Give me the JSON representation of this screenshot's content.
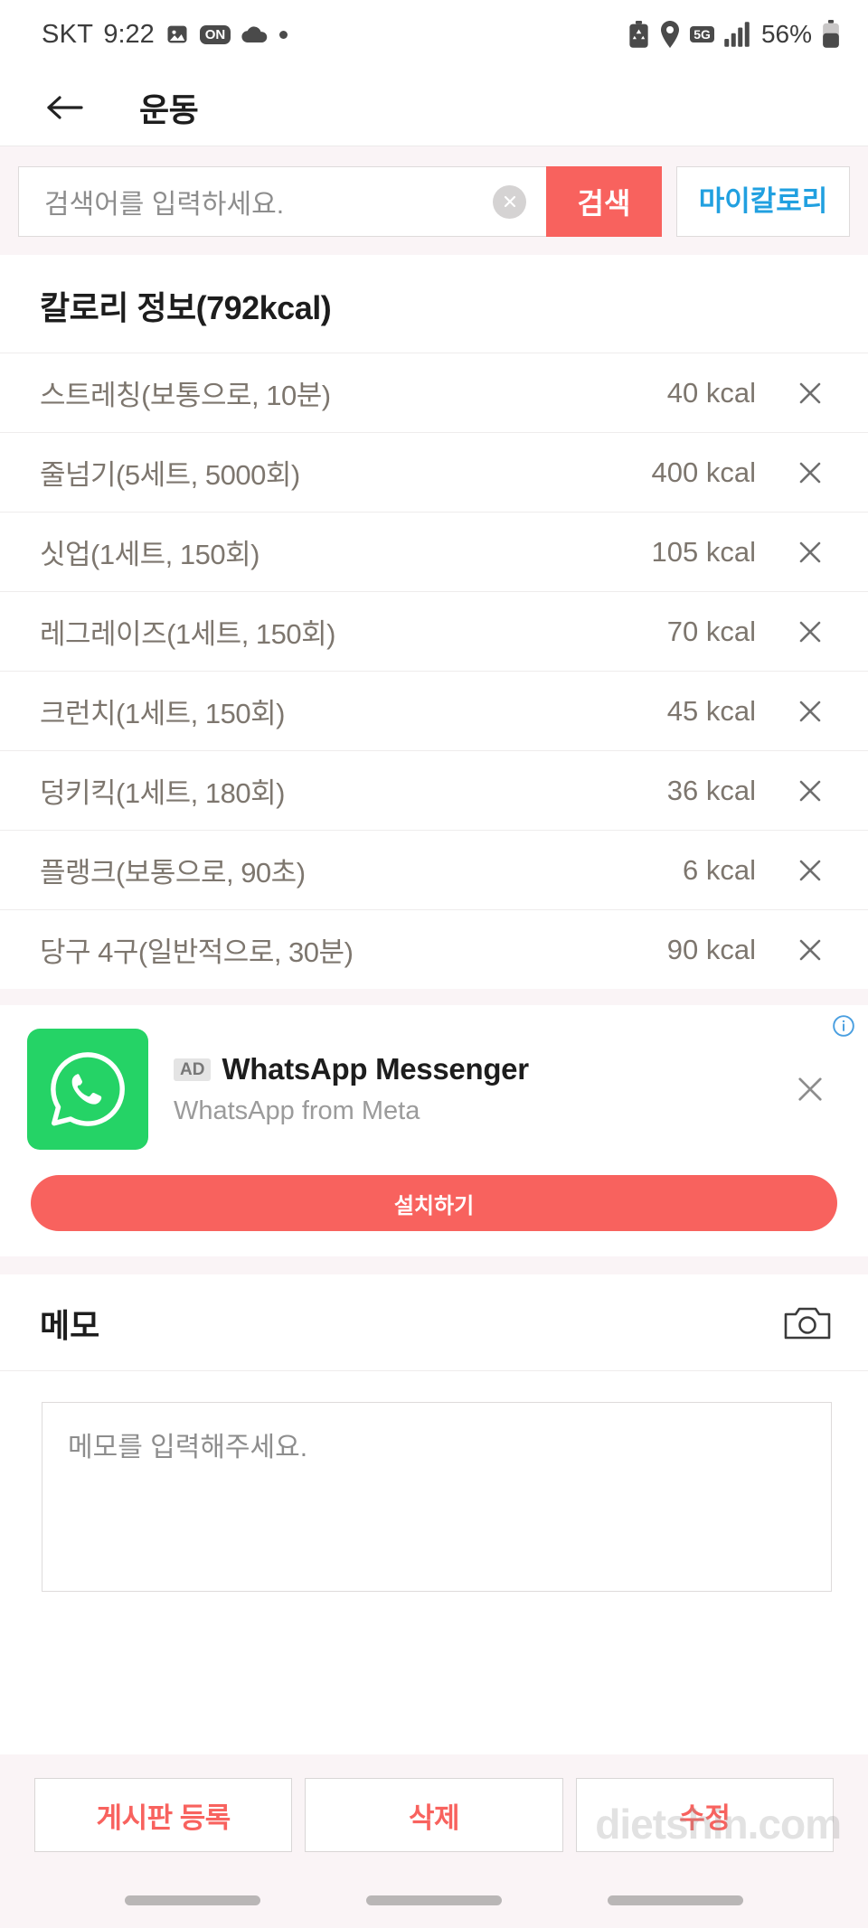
{
  "status_bar": {
    "carrier": "SKT",
    "time": "9:22",
    "battery_percent": "56%",
    "network_badge": "5G",
    "icons": [
      "image-icon",
      "on-badge-icon",
      "cloud-icon",
      "dot-icon",
      "battery-recycle-icon",
      "location-pin-icon",
      "signal-bars-icon",
      "battery-icon"
    ]
  },
  "app_bar": {
    "back_label": "back-arrow",
    "title": "운동"
  },
  "search": {
    "placeholder": "검색어를 입력하세요.",
    "value": "",
    "clear_label": "×",
    "search_button": "검색",
    "mycalorie_button": "마이칼로리"
  },
  "calorie_section": {
    "title": "칼로리 정보(792kcal)",
    "total_kcal": "792kcal",
    "rows": [
      {
        "name": "스트레칭(보통으로, 10분)",
        "kcal": "40 kcal"
      },
      {
        "name": "줄넘기(5세트, 5000회)",
        "kcal": "400 kcal"
      },
      {
        "name": "싯업(1세트, 150회)",
        "kcal": "105 kcal"
      },
      {
        "name": "레그레이즈(1세트, 150회)",
        "kcal": "70 kcal"
      },
      {
        "name": "크런치(1세트, 150회)",
        "kcal": "45 kcal"
      },
      {
        "name": "덩키킥(1세트, 180회)",
        "kcal": "36 kcal"
      },
      {
        "name": "플랭크(보통으로, 90초)",
        "kcal": "6 kcal"
      },
      {
        "name": "당구 4구(일반적으로, 30분)",
        "kcal": "90 kcal"
      }
    ]
  },
  "ad": {
    "badge": "AD",
    "title": "WhatsApp Messenger",
    "subtitle": "WhatsApp from Meta",
    "cta": "설치하기",
    "icon_color": "#25D366"
  },
  "memo": {
    "title": "메모",
    "placeholder": "메모를 입력해주세요.",
    "value": ""
  },
  "actions": {
    "buttons": [
      "게시판 등록",
      "삭제",
      "수정"
    ]
  },
  "watermark": "dietshin.com",
  "colors": {
    "accent_red": "#f8625e",
    "link_blue": "#21a0e0",
    "page_bg": "#faf4f6",
    "text_muted": "#7d766e"
  }
}
